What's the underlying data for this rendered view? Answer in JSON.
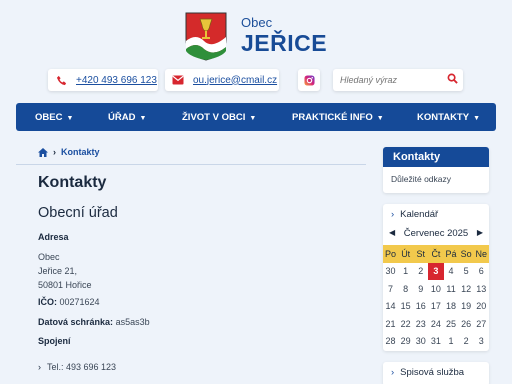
{
  "brand": {
    "subtitle": "Obec",
    "title": "JEŘICE"
  },
  "contacts": {
    "phone": "+420 493 696 123",
    "email": "ou.jerice@cmail.cz",
    "search_placeholder": "Hledaný výraz"
  },
  "nav": {
    "items": [
      {
        "label": "OBEC"
      },
      {
        "label": "ÚŘAD"
      },
      {
        "label": "ŽIVOT V OBCI"
      },
      {
        "label": "PRAKTICKÉ INFO"
      },
      {
        "label": "KONTAKTY"
      }
    ]
  },
  "breadcrumb": {
    "current": "Kontakty"
  },
  "main": {
    "title": "Kontakty",
    "section_title": "Obecní úřad",
    "address_label": "Adresa",
    "address_lines": [
      "Obec",
      "Jeřice 21,",
      "50801 Hořice"
    ],
    "ico_label": "IČO:",
    "ico_value": "00271624",
    "ds_label": "Datová schránka:",
    "ds_value": "as5as3b",
    "connection_label": "Spojení",
    "tel": "Tel.: 493 696 123"
  },
  "sidebar": {
    "contacts_title": "Kontakty",
    "contacts_link": "Důležité odkazy",
    "calendar_title": "Kalendář",
    "calendar_month": "Červenec 2025",
    "weekdays": [
      "Po",
      "Út",
      "St",
      "Čt",
      "Pá",
      "So",
      "Ne"
    ],
    "weeks": [
      [
        "30",
        "1",
        "2",
        "3",
        "4",
        "5",
        "6"
      ],
      [
        "7",
        "8",
        "9",
        "10",
        "11",
        "12",
        "13"
      ],
      [
        "14",
        "15",
        "16",
        "17",
        "18",
        "19",
        "20"
      ],
      [
        "21",
        "22",
        "23",
        "24",
        "25",
        "26",
        "27"
      ],
      [
        "28",
        "29",
        "30",
        "31",
        "1",
        "2",
        "3"
      ]
    ],
    "today": "3",
    "spis_title": "Spisová služba"
  },
  "colors": {
    "primary": "#154a98",
    "background": "#eef3fa",
    "accent_red": "#d7262f",
    "weekday_yellow": "#f2c94c"
  },
  "icons": [
    "crest-logo",
    "phone-icon",
    "mail-icon",
    "instagram-icon",
    "search-icon",
    "home-icon",
    "chevron-right-icon",
    "chevron-down-icon"
  ]
}
